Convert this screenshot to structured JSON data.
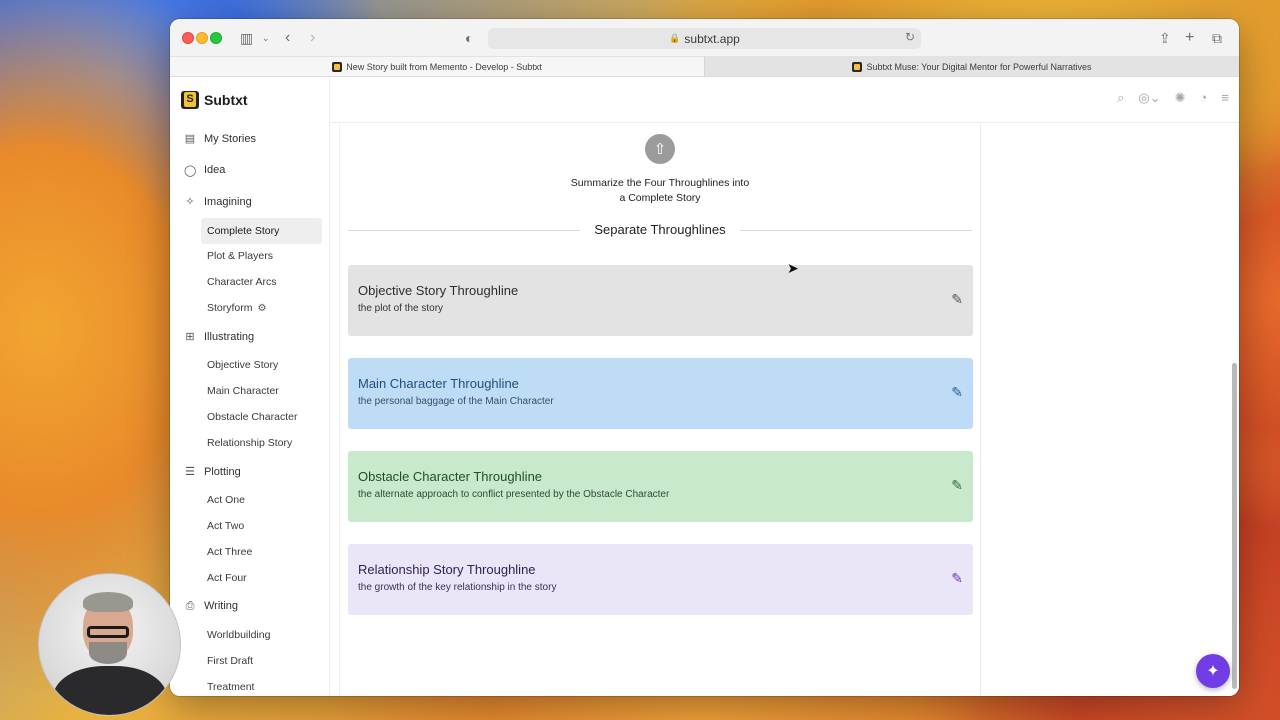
{
  "browser": {
    "url": "subtxt.app",
    "tabs": [
      {
        "title": "New Story built from Memento - Develop - Subtxt",
        "active": true
      },
      {
        "title": "Subtxt Muse: Your Digital Mentor for Powerful Narratives",
        "active": false
      }
    ]
  },
  "brand": {
    "name": "Subtxt"
  },
  "sidebar": {
    "my_stories": "My Stories",
    "idea": "Idea",
    "imagining": {
      "label": "Imagining",
      "items": [
        "Complete Story",
        "Plot & Players",
        "Character Arcs",
        "Storyform"
      ]
    },
    "illustrating": {
      "label": "Illustrating",
      "items": [
        "Objective Story",
        "Main Character",
        "Obstacle Character",
        "Relationship Story"
      ]
    },
    "plotting": {
      "label": "Plotting",
      "items": [
        "Act One",
        "Act Two",
        "Act Three",
        "Act Four"
      ]
    },
    "writing": {
      "label": "Writing",
      "items": [
        "Worldbuilding",
        "First Draft",
        "Treatment"
      ]
    }
  },
  "main": {
    "summary_line1": "Summarize the Four Throughlines into",
    "summary_line2": "a Complete Story",
    "divider_label": "Separate Throughlines",
    "cards": [
      {
        "title": "Objective Story Throughline",
        "desc": "the plot of the story"
      },
      {
        "title": "Main Character Throughline",
        "desc": "the personal baggage of the Main Character"
      },
      {
        "title": "Obstacle Character Throughline",
        "desc": "the alternate approach to conflict presented by the Obstacle Character"
      },
      {
        "title": "Relationship Story Throughline",
        "desc": "the growth of the key relationship in the story"
      }
    ]
  },
  "colors": {
    "objective": "#e3e3e3",
    "main_character": "#bfdcf7",
    "obstacle_character": "#c8e9cc",
    "relationship": "#eae6f8",
    "fab": "#6f3ce6"
  }
}
